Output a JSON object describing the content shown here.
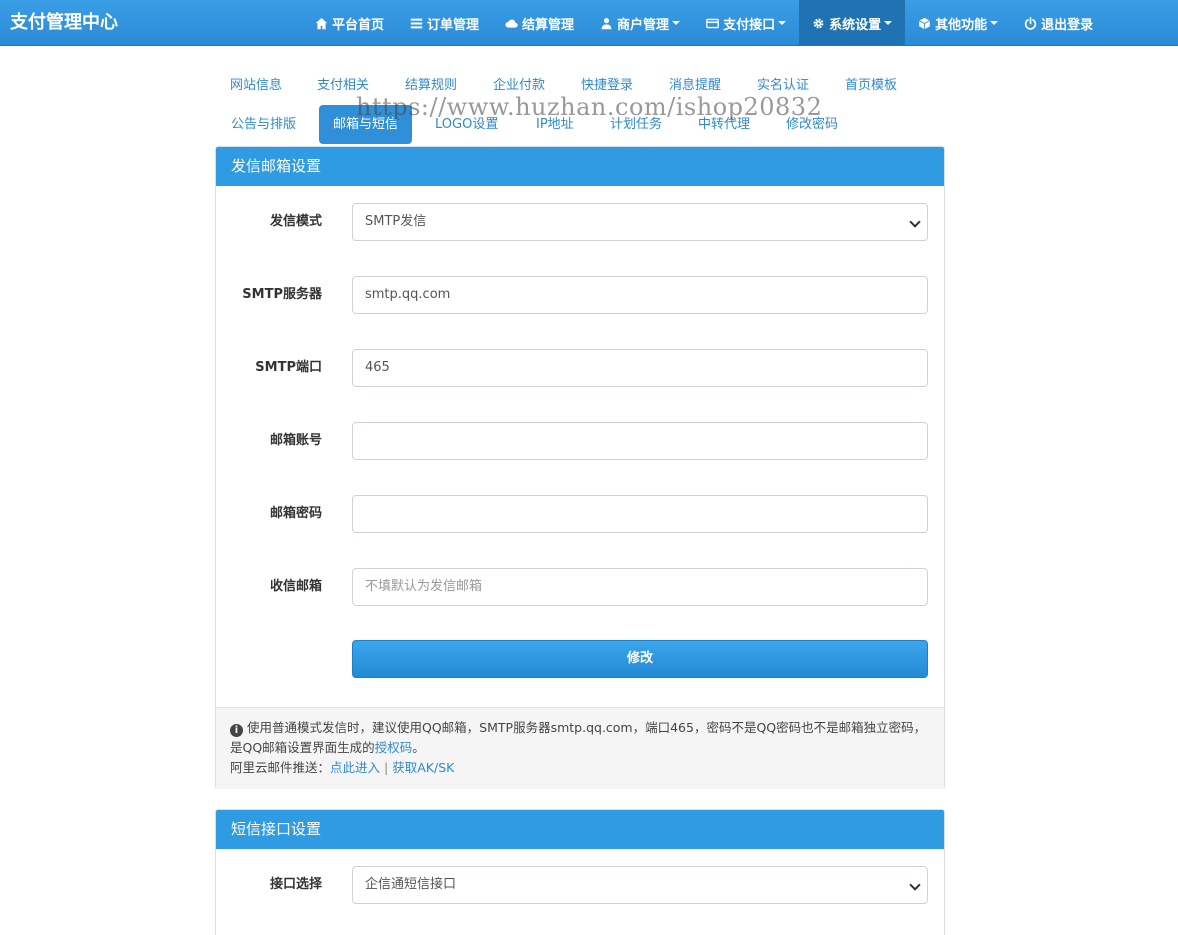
{
  "app": {
    "brand": "支付管理中心"
  },
  "nav": [
    {
      "label": "平台首页",
      "icon": "home-icon",
      "dropdown": false,
      "active": false
    },
    {
      "label": "订单管理",
      "icon": "list-icon",
      "dropdown": false,
      "active": false
    },
    {
      "label": "结算管理",
      "icon": "cloud-icon",
      "dropdown": false,
      "active": false
    },
    {
      "label": "商户管理",
      "icon": "user-icon",
      "dropdown": true,
      "active": false
    },
    {
      "label": "支付接口",
      "icon": "credit-card-icon",
      "dropdown": true,
      "active": false
    },
    {
      "label": "系统设置",
      "icon": "gear-icon",
      "dropdown": true,
      "active": true
    },
    {
      "label": "其他功能",
      "icon": "cube-icon",
      "dropdown": true,
      "active": false
    },
    {
      "label": "退出登录",
      "icon": "power-icon",
      "dropdown": false,
      "active": false
    }
  ],
  "tabs": [
    {
      "label": "网站信息",
      "active": false
    },
    {
      "label": "支付相关",
      "active": false
    },
    {
      "label": "结算规则",
      "active": false
    },
    {
      "label": "企业付款",
      "active": false
    },
    {
      "label": "快捷登录",
      "active": false
    },
    {
      "label": "消息提醒",
      "active": false
    },
    {
      "label": "实名认证",
      "active": false
    },
    {
      "label": "首页模板",
      "active": false
    },
    {
      "label": "公告与排版",
      "active": false
    },
    {
      "label": "邮箱与短信",
      "active": true
    },
    {
      "label": "LOGO设置",
      "active": false
    },
    {
      "label": "IP地址",
      "active": false
    },
    {
      "label": "计划任务",
      "active": false
    },
    {
      "label": "中转代理",
      "active": false
    },
    {
      "label": "修改密码",
      "active": false
    }
  ],
  "watermark": "https://www.huzhan.com/ishop20832",
  "mail_panel": {
    "title": "发信邮箱设置",
    "fields": [
      {
        "label": "发信模式",
        "type": "select",
        "value": "SMTP发信",
        "placeholder": ""
      },
      {
        "label": "SMTP服务器",
        "type": "input",
        "value": "smtp.qq.com",
        "placeholder": ""
      },
      {
        "label": "SMTP端口",
        "type": "input",
        "value": "465",
        "placeholder": ""
      },
      {
        "label": "邮箱账号",
        "type": "input",
        "value": "",
        "placeholder": ""
      },
      {
        "label": "邮箱密码",
        "type": "input",
        "value": "",
        "placeholder": ""
      },
      {
        "label": "收信邮箱",
        "type": "input",
        "value": "",
        "placeholder": "不填默认为发信邮箱"
      }
    ],
    "submit_label": "修改",
    "help": {
      "text_1": "使用普通模式发信时，建议使用QQ邮箱，SMTP服务器smtp.qq.com，端口465，密码不是QQ密码也不是邮箱独立密码，是QQ邮箱设置界面生成的",
      "link_auth": "授权码",
      "text_1_end": "。",
      "text_2": "阿里云邮件推送：",
      "link_enter": "点此进入",
      "separator": "|",
      "link_aksk": "获取AK/SK"
    }
  },
  "sms_panel": {
    "title": "短信接口设置",
    "fields": [
      {
        "label": "接口选择",
        "type": "select",
        "value": "企信通短信接口"
      }
    ]
  }
}
